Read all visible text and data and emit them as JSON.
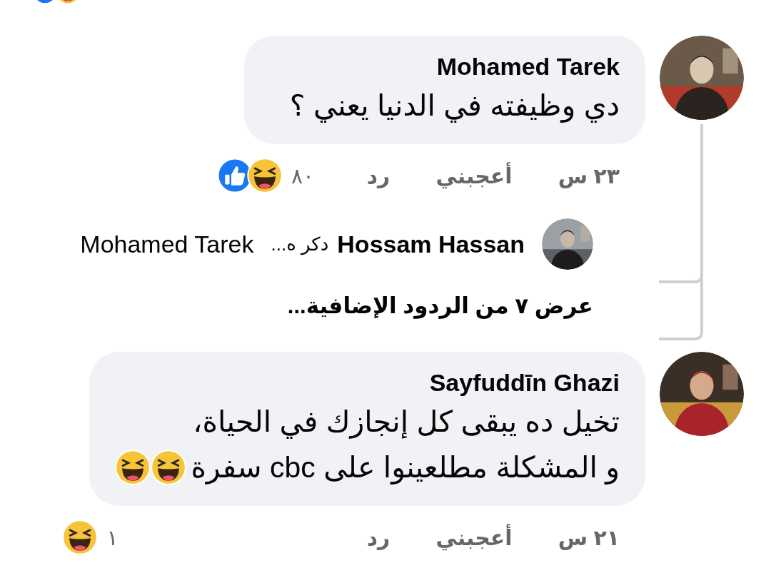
{
  "previous_comment": {
    "reactions": [
      {
        "kind": "like"
      },
      {
        "kind": "haha"
      }
    ]
  },
  "comments": [
    {
      "author": "Mohamed Tarek",
      "lines": [
        "دي وظيفته في الدنيا يعني ؟"
      ],
      "time": "٢٣ س",
      "like_label": "أعجبني",
      "reply_label": "رد",
      "reaction_count": "٨٠",
      "reactions": [
        {
          "kind": "haha"
        },
        {
          "kind": "like"
        }
      ],
      "replies": [
        {
          "author": "Hossam Hassan",
          "snippet": "دكر ه...",
          "mention": "Mohamed Tarek"
        }
      ],
      "more_replies": "عرض ٧ من الردود الإضافية..."
    },
    {
      "author": "Sayfuddīn Ghazi",
      "lines": [
        "تخيل ده يبقى كل إنجازك في الحياة،",
        "و المشكلة مطلعينوا على cbc سفرة"
      ],
      "emojis": [
        {
          "kind": "haha"
        },
        {
          "kind": "haha"
        }
      ],
      "time": "٢١ س",
      "like_label": "أعجبني",
      "reply_label": "رد",
      "reaction_count": "١",
      "reactions": [
        {
          "kind": "haha"
        }
      ]
    }
  ]
}
